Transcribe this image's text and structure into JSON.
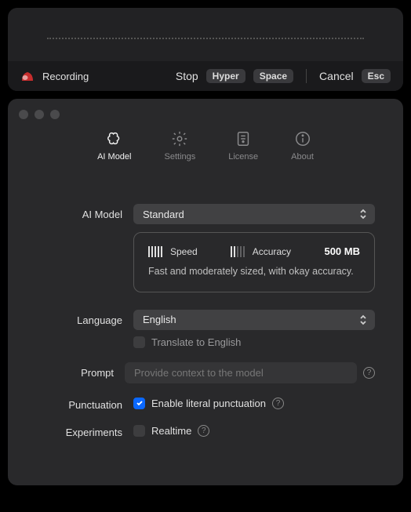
{
  "recording": {
    "status_label": "Recording",
    "stop_label": "Stop",
    "stop_key1": "Hyper",
    "stop_key2": "Space",
    "cancel_label": "Cancel",
    "cancel_key": "Esc"
  },
  "tabs": {
    "ai_model": "AI Model",
    "settings": "Settings",
    "license": "License",
    "about": "About"
  },
  "form": {
    "model": {
      "label": "AI Model",
      "value": "Standard",
      "speed_label": "Speed",
      "accuracy_label": "Accuracy",
      "size": "500 MB",
      "desc": "Fast and moderately sized, with okay accuracy."
    },
    "language": {
      "label": "Language",
      "value": "English",
      "translate_label": "Translate to English"
    },
    "prompt": {
      "label": "Prompt",
      "placeholder": "Provide context to the model"
    },
    "punct": {
      "label": "Punctuation",
      "cb_label": "Enable literal punctuation"
    },
    "exp": {
      "label": "Experiments",
      "cb_label": "Realtime"
    }
  }
}
